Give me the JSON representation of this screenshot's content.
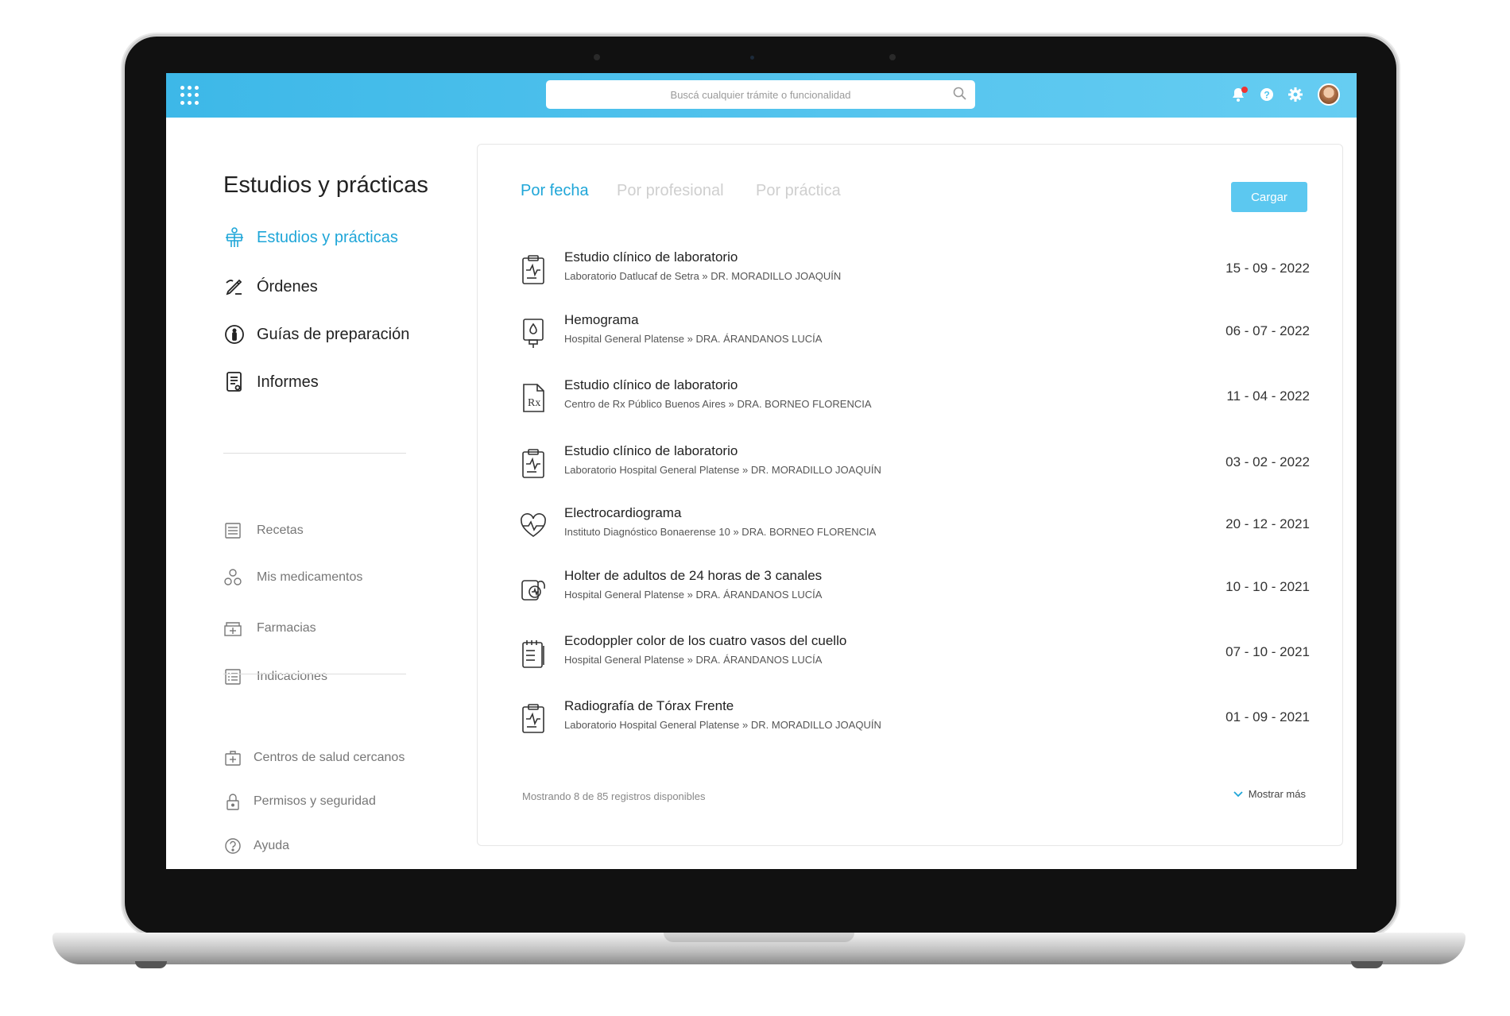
{
  "search": {
    "placeholder": "Buscá cualquier trámite o funcionalidad"
  },
  "page": {
    "title": "Estudios y prácticas"
  },
  "sidebar": {
    "main_items": [
      {
        "label": "Estudios y prácticas",
        "icon": "body-scan-icon",
        "active": true
      },
      {
        "label": "Órdenes",
        "icon": "pencil-order-icon"
      },
      {
        "label": "Guías de preparación",
        "icon": "info-person-icon"
      },
      {
        "label": "Informes",
        "icon": "report-document-icon"
      }
    ],
    "secondary_items": [
      {
        "label": "Recetas",
        "icon": "prescription-list-icon"
      },
      {
        "label": "Mis medicamentos",
        "icon": "pills-icon"
      },
      {
        "label": "Farmacias",
        "icon": "pharmacy-icon"
      },
      {
        "label": "Indicaciones",
        "icon": "checklist-icon"
      }
    ],
    "tertiary_items": [
      {
        "label": "Centros de salud cercanos",
        "icon": "medical-kit-icon"
      },
      {
        "label": "Permisos y seguridad",
        "icon": "lock-icon"
      },
      {
        "label": "Ayuda",
        "icon": "help-icon"
      }
    ]
  },
  "tabs": [
    {
      "label": "Por fecha",
      "active": true
    },
    {
      "label": "Por profesional"
    },
    {
      "label": "Por práctica"
    }
  ],
  "actions": {
    "upload_label": "Cargar"
  },
  "records": [
    {
      "title": "Estudio clínico de laboratorio",
      "subtitle": "Laboratorio Datlucaf de Setra » DR. MORADILLO JOAQUÍN",
      "date": "15 - 09 - 2022",
      "icon": "clipboard-pulse-icon"
    },
    {
      "title": "Hemograma",
      "subtitle": "Hospital General Platense » DRA. ÁRANDANOS LUCÍA",
      "date": "06 - 07 - 2022",
      "icon": "blood-bag-icon"
    },
    {
      "title": "Estudio clínico de laboratorio",
      "subtitle": "Centro de Rx Público Buenos Aires » DRA. BORNEO FLORENCIA",
      "date": "11 - 04 - 2022",
      "icon": "rx-document-icon"
    },
    {
      "title": "Estudio clínico de laboratorio",
      "subtitle": "Laboratorio Hospital General Platense » DR. MORADILLO JOAQUÍN",
      "date": "03 - 02 - 2022",
      "icon": "clipboard-pulse-icon"
    },
    {
      "title": "Electrocardiograma",
      "subtitle": "Instituto Diagnóstico Bonaerense 10 » DRA. BORNEO FLORENCIA",
      "date": "20 - 12 - 2021",
      "icon": "heart-pulse-icon"
    },
    {
      "title": "Holter de adultos de 24 horas de 3 canales",
      "subtitle": "Hospital General Platense » DRA. ÁRANDANOS LUCÍA",
      "date": "10 - 10 - 2021",
      "icon": "holter-device-icon"
    },
    {
      "title": "Ecodoppler color de los cuatro vasos del cuello",
      "subtitle": "Hospital General Platense » DRA. ÁRANDANOS LUCÍA",
      "date": "07 - 10 - 2021",
      "icon": "notepad-icon"
    },
    {
      "title": "Radiografía de Tórax Frente",
      "subtitle": "Laboratorio Hospital General Platense » DR. MORADILLO JOAQUÍN",
      "date": "01 - 09 - 2021",
      "icon": "clipboard-pulse-icon"
    }
  ],
  "footer": {
    "summary": "Mostrando 8 de 85 registros disponibles",
    "more_label": "Mostrar más"
  },
  "colors": {
    "accent": "#1fa6d8",
    "topbar": "#4cc3ee",
    "button": "#5cc8f0"
  }
}
